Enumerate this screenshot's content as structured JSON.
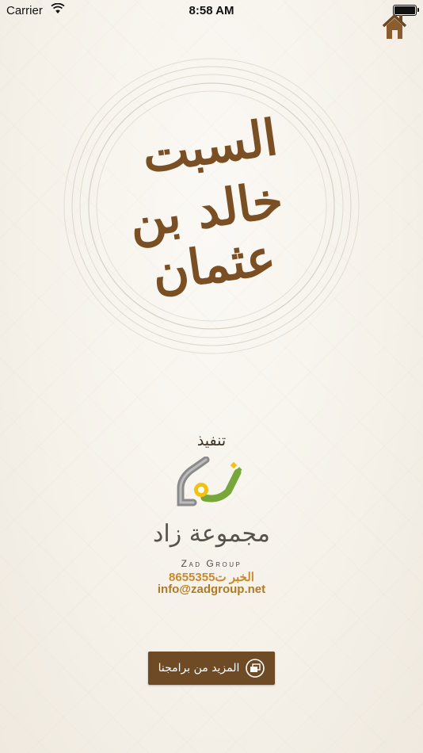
{
  "status_bar": {
    "carrier": "Carrier",
    "time": "8:58 AM"
  },
  "header": {
    "home_icon": "home-icon"
  },
  "logo": {
    "line1": "السبت",
    "line2": "خالد بن عثمان",
    "color": "#7a4f24"
  },
  "credits": {
    "executed_by": "تنفيذ",
    "group_name_ar": "مجموعة زاد",
    "group_name_en": "Zad Group",
    "phone": "الخبر  ت8655355",
    "email": "info@zadgroup.net"
  },
  "more_button": {
    "label": "المزيد من برامجنا",
    "background": "#6e4a25"
  }
}
